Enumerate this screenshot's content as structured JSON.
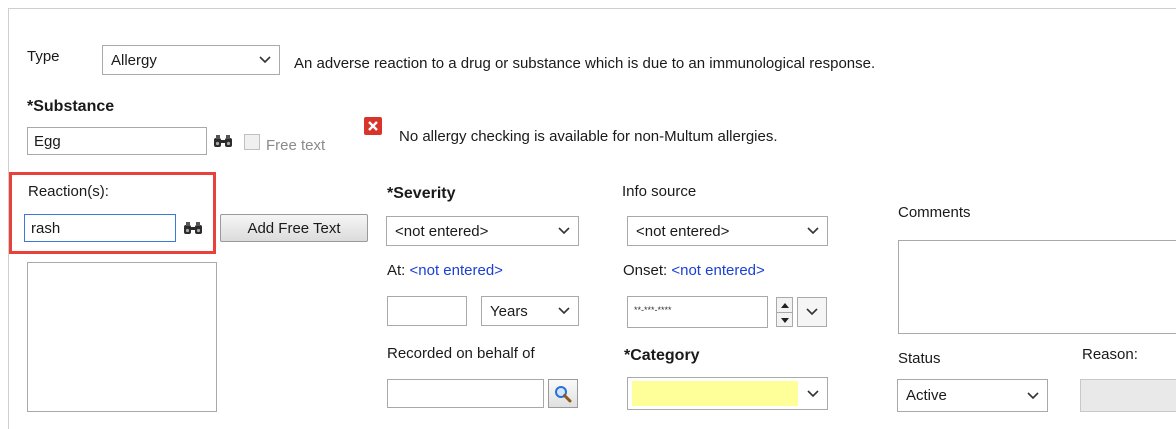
{
  "type": {
    "label": "Type",
    "value": "Allergy",
    "description": "An adverse reaction to a drug or substance which is due to an immunological response."
  },
  "substance": {
    "label": "*Substance",
    "value": "Egg",
    "free_text_label": "Free text",
    "warning": "No allergy checking is available for non-Multum allergies."
  },
  "reactions": {
    "label": "Reaction(s):",
    "value": "rash",
    "add_free_text_label": "Add Free Text",
    "highlight_color": "#e8413c"
  },
  "severity": {
    "label": "*Severity",
    "value": "<not entered>",
    "at_label": "At:",
    "at_value": "<not entered>",
    "age_value": "",
    "age_unit": "Years"
  },
  "info_source": {
    "label": "Info source",
    "value": "<not entered>",
    "onset_label": "Onset:",
    "onset_value": "<not entered>",
    "onset_date": "**-***-****"
  },
  "recorded": {
    "label": "Recorded on behalf of",
    "value": ""
  },
  "category": {
    "label": "*Category",
    "value": "",
    "fill_color": "#ffff99"
  },
  "comments": {
    "label": "Comments",
    "value": ""
  },
  "status": {
    "label": "Status",
    "value": "Active"
  },
  "reason": {
    "label": "Reason:",
    "value": ""
  },
  "icons": {
    "binoculars": "binoculars-icon",
    "warning": "error-x-icon",
    "magnifier": "magnifier-icon",
    "chevron": "chevron-down-icon"
  }
}
